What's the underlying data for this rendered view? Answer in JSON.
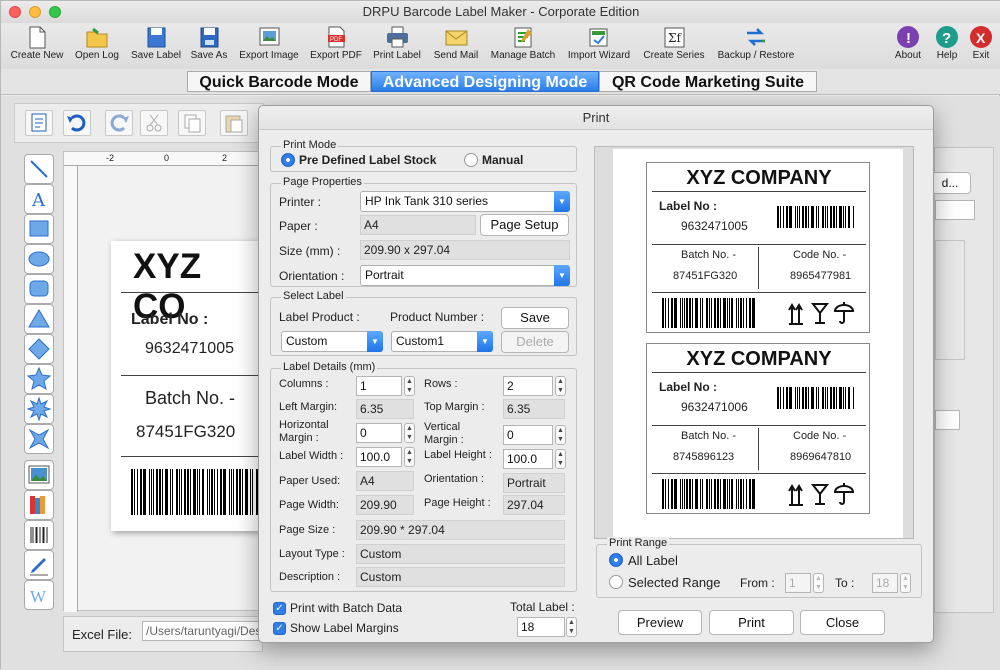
{
  "window": {
    "title": "DRPU Barcode Label Maker - Corporate Edition"
  },
  "toolbar": [
    {
      "label": "Create New",
      "icon": "new-document-icon"
    },
    {
      "label": "Open Log",
      "icon": "open-folder-icon"
    },
    {
      "label": "Save Label",
      "icon": "save-disk-icon"
    },
    {
      "label": "Save As",
      "icon": "save-as-icon"
    },
    {
      "label": "Export Image",
      "icon": "export-image-icon"
    },
    {
      "label": "Export PDF",
      "icon": "export-pdf-icon"
    },
    {
      "label": "Print Label",
      "icon": "printer-icon"
    },
    {
      "label": "Send Mail",
      "icon": "mail-icon"
    },
    {
      "label": "Manage Batch",
      "icon": "manage-batch-icon"
    },
    {
      "label": "Import Wizard",
      "icon": "import-wizard-icon"
    },
    {
      "label": "Create Series",
      "icon": "create-series-icon"
    },
    {
      "label": "Backup / Restore",
      "icon": "backup-restore-icon"
    },
    {
      "label": "About",
      "icon": "about-icon"
    },
    {
      "label": "Help",
      "icon": "help-icon"
    },
    {
      "label": "Exit",
      "icon": "exit-icon"
    }
  ],
  "modes": {
    "quick": "Quick Barcode Mode",
    "advanced": "Advanced Designing Mode",
    "qr": "QR Code Marketing Suite",
    "active": "advanced"
  },
  "canvas": {
    "ruler_numbers": [
      "-2",
      "0",
      "2"
    ],
    "label": {
      "company": "XYZ CO",
      "label_no_title": "Label No :",
      "label_no": "9632471005",
      "batch_title": "Batch No. -",
      "batch_no": "87451FG320"
    }
  },
  "right_panel": {
    "button_partial": "d...",
    "excel_file_label": "Excel File:",
    "excel_file_path": "/Users/taruntyagi/Des"
  },
  "print_dialog": {
    "title": "Print",
    "print_mode": {
      "title": "Print Mode",
      "predefined": "Pre Defined Label Stock",
      "manual": "Manual",
      "selected": "predefined"
    },
    "page_properties": {
      "title": "Page Properties",
      "printer_label": "Printer :",
      "printer": "HP Ink Tank 310 series",
      "paper_label": "Paper :",
      "paper": "A4",
      "page_setup": "Page Setup",
      "size_label": "Size (mm) :",
      "size": "209.90 x 297.04",
      "orientation_label": "Orientation :",
      "orientation": "Portrait"
    },
    "select_label": {
      "title": "Select Label",
      "product_label": "Label Product :",
      "product": "Custom",
      "product_number_label": "Product Number :",
      "product_number": "Custom1",
      "save": "Save",
      "delete": "Delete"
    },
    "label_details": {
      "title": "Label Details (mm)",
      "columns_label": "Columns :",
      "columns": "1",
      "rows_label": "Rows :",
      "rows": "2",
      "left_margin_label": "Left Margin:",
      "left_margin": "6.35",
      "top_margin_label": "Top Margin :",
      "top_margin": "6.35",
      "horizontal_margin_label_1": "Horizontal",
      "horizontal_margin_label_2": "Margin :",
      "horizontal_margin": "0",
      "vertical_margin_label_1": "Vertical",
      "vertical_margin_label_2": "Margin :",
      "vertical_margin": "0",
      "label_width_label": "Label Width :",
      "label_width": "100.0",
      "label_height_label": "Label Height :",
      "label_height": "100.0",
      "paper_used_label": "Paper Used:",
      "paper_used": "A4",
      "orientation_label": "Orientation :",
      "orientation": "Portrait",
      "page_width_label": "Page Width:",
      "page_width": "209.90",
      "page_height_label": "Page Height :",
      "page_height": "297.04",
      "page_size_label": "Page Size :",
      "page_size": "209.90 * 297.04",
      "layout_type_label": "Layout Type :",
      "layout_type": "Custom",
      "description_label": "Description :",
      "description": "Custom"
    },
    "print_with_batch": "Print with Batch Data",
    "show_margins": "Show Label Margins",
    "total_label_title": "Total Label :",
    "total_label": "18",
    "preview_labels": [
      {
        "company": "XYZ COMPANY",
        "label_no_title": "Label No :",
        "label_no": "9632471005",
        "batch_title": "Batch No. -",
        "batch_no": "87451FG320",
        "code_title": "Code No. -",
        "code_no": "8965477981"
      },
      {
        "company": "XYZ COMPANY",
        "label_no_title": "Label No :",
        "label_no": "9632471006",
        "batch_title": "Batch No. -",
        "batch_no": "8745896123",
        "code_title": "Code No. -",
        "code_no": "8969647810"
      }
    ],
    "print_range": {
      "title": "Print Range",
      "all": "All Label",
      "selected": "Selected Range",
      "from_label": "From :",
      "from": "1",
      "to_label": "To :",
      "to": "18",
      "current": "all"
    },
    "buttons": {
      "preview": "Preview",
      "print": "Print",
      "close": "Close"
    }
  }
}
